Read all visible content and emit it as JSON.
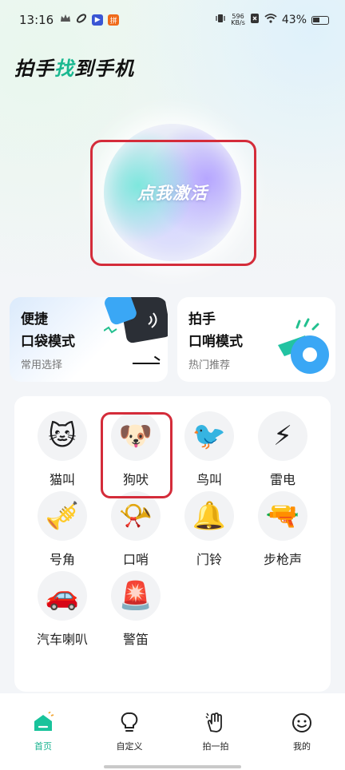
{
  "status_bar": {
    "time": "13:16",
    "net_speed_value": "596",
    "net_speed_unit": "KB/s",
    "battery": "43%",
    "icons": [
      "crown-icon",
      "link-icon",
      "play-icon",
      "app-icon",
      "vibrate-icon",
      "sim-icon",
      "wifi-icon",
      "battery-icon"
    ]
  },
  "app": {
    "title_part1": "拍手",
    "title_highlight": "找",
    "title_part2": "到手机"
  },
  "activate": {
    "label": "点我激活"
  },
  "modes": [
    {
      "title": "便捷\n口袋模式",
      "subtitle": "常用选择",
      "icon": "phone-pocket-icon"
    },
    {
      "title": "拍手\n口哨模式",
      "subtitle": "热门推荐",
      "icon": "whistle-icon"
    }
  ],
  "sounds": [
    {
      "label": "猫叫",
      "icon": "cat-icon",
      "glyph": "🐱"
    },
    {
      "label": "狗吠",
      "icon": "dog-icon",
      "glyph": "🐶"
    },
    {
      "label": "鸟叫",
      "icon": "bird-icon",
      "glyph": "🐦"
    },
    {
      "label": "雷电",
      "icon": "lightning-icon",
      "glyph": "⚡"
    },
    {
      "label": "号角",
      "icon": "horn-icon",
      "glyph": "🎺"
    },
    {
      "label": "口哨",
      "icon": "whistle-icon",
      "glyph": "📯"
    },
    {
      "label": "门铃",
      "icon": "doorbell-icon",
      "glyph": "🔔"
    },
    {
      "label": "步枪声",
      "icon": "rifle-icon",
      "glyph": "🔫"
    },
    {
      "label": "汽车喇叭",
      "icon": "car-horn-icon",
      "glyph": "🚗"
    },
    {
      "label": "警笛",
      "icon": "siren-icon",
      "glyph": "🚨"
    }
  ],
  "nav": [
    {
      "label": "首页",
      "icon": "home-icon",
      "active": true
    },
    {
      "label": "自定义",
      "icon": "lightbulb-icon",
      "active": false
    },
    {
      "label": "拍一拍",
      "icon": "hand-icon",
      "active": false
    },
    {
      "label": "我的",
      "icon": "smile-icon",
      "active": false
    }
  ],
  "colors": {
    "accent": "#16b28e",
    "highlight_frame": "#d42c3a"
  }
}
